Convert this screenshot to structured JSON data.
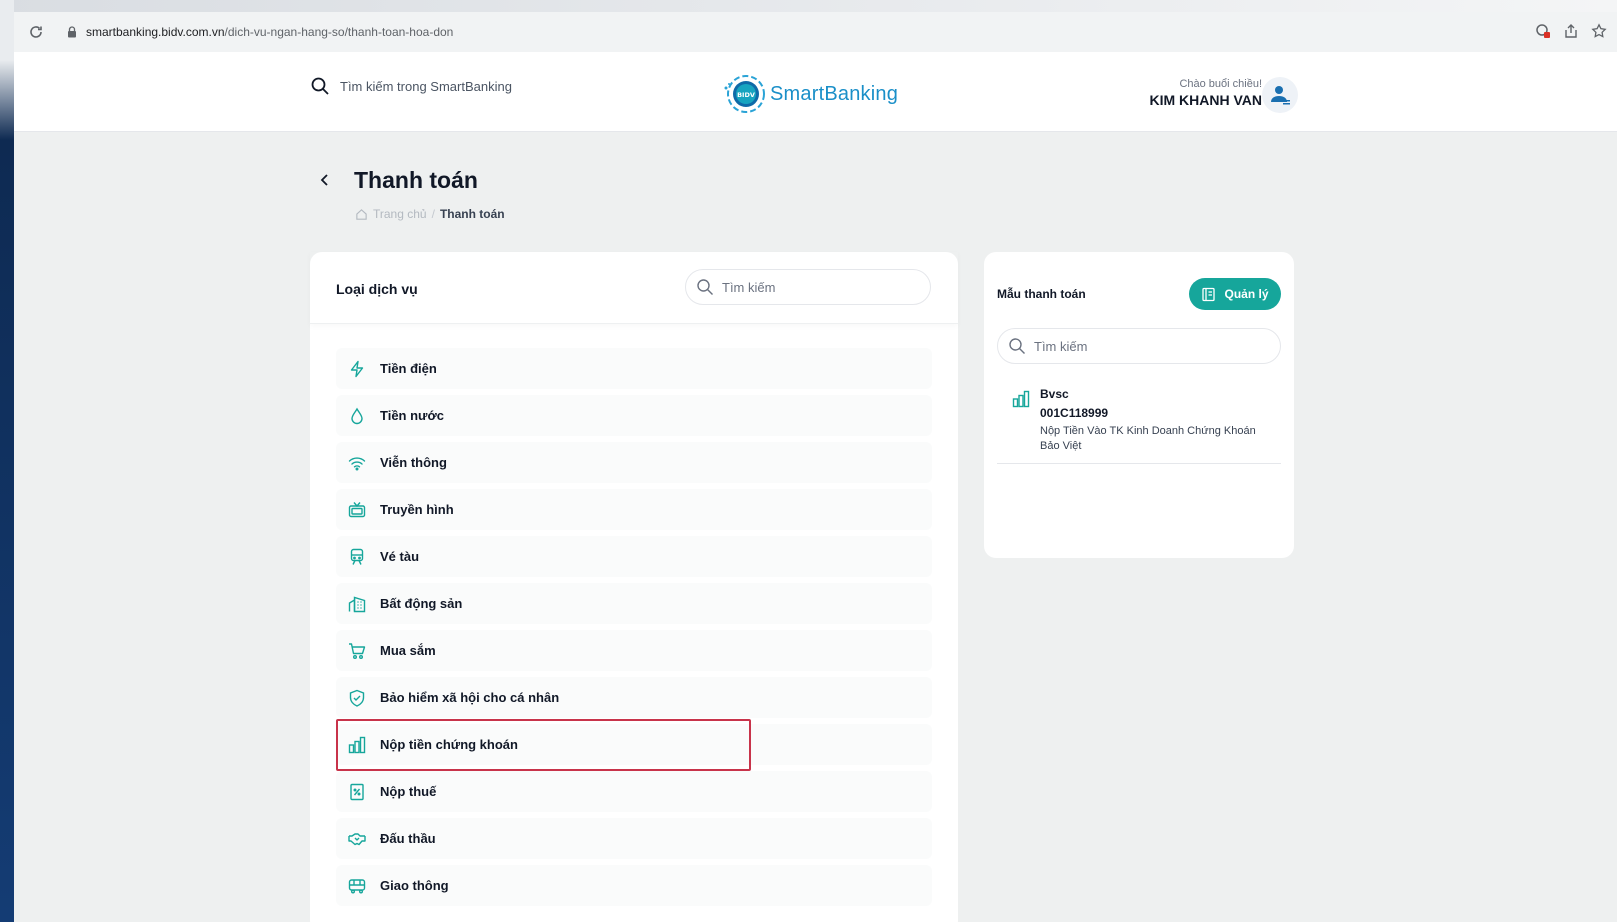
{
  "browser": {
    "url_host": "smartbanking.bidv.com.vn",
    "url_path": "/dich-vu-ngan-hang-so/thanh-toan-hoa-don"
  },
  "header": {
    "search_placeholder": "Tìm kiếm trong SmartBanking",
    "logo_badge": "BIDV",
    "logo_text": "SmartBanking",
    "greeting": "Chào buổi chiều!",
    "user_name": "KIM KHANH VAN"
  },
  "page": {
    "title": "Thanh toán",
    "breadcrumb_home": "Trang chủ",
    "breadcrumb_sep": "/",
    "breadcrumb_current": "Thanh toán"
  },
  "services": {
    "title": "Loại dịch vụ",
    "search_placeholder": "Tìm kiếm",
    "items": [
      {
        "label": "Tiền điện",
        "icon": "lightning-icon"
      },
      {
        "label": "Tiền nước",
        "icon": "water-drop-icon"
      },
      {
        "label": "Viễn thông",
        "icon": "wifi-icon"
      },
      {
        "label": "Truyền hình",
        "icon": "tv-icon"
      },
      {
        "label": "Vé tàu",
        "icon": "train-icon"
      },
      {
        "label": "Bất động sản",
        "icon": "building-icon"
      },
      {
        "label": "Mua sắm",
        "icon": "cart-icon"
      },
      {
        "label": "Bảo hiểm xã hội cho cá nhân",
        "icon": "shield-icon"
      },
      {
        "label": "Nộp tiền chứng khoán",
        "icon": "bar-chart-icon"
      },
      {
        "label": "Nộp thuế",
        "icon": "receipt-icon"
      },
      {
        "label": "Đấu thầu",
        "icon": "handshake-icon"
      },
      {
        "label": "Giao thông",
        "icon": "bus-icon"
      }
    ]
  },
  "templates": {
    "title": "Mẫu thanh toán",
    "manage_label": "Quản lý",
    "search_placeholder": "Tìm kiếm",
    "items": [
      {
        "name": "Bvsc",
        "code": "001C118999",
        "description": "Nộp Tiền Vào TK Kinh Doanh Chứng Khoán Bảo Việt",
        "icon": "bar-chart-icon"
      }
    ]
  },
  "colors": {
    "accent": "#16a69b",
    "brand_blue": "#1a8fc8",
    "highlight": "#c8334a"
  }
}
